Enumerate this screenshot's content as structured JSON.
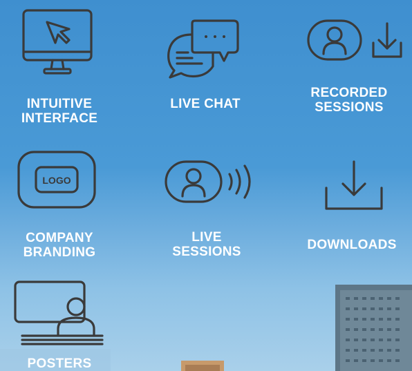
{
  "features": [
    {
      "id": "intuitive-interface",
      "label_lines": [
        "INTUITIVE",
        "INTERFACE"
      ],
      "icon": "monitor-cursor-icon"
    },
    {
      "id": "live-chat",
      "label_lines": [
        "LIVE CHAT"
      ],
      "icon": "chat-bubbles-icon"
    },
    {
      "id": "recorded-sessions",
      "label_lines": [
        "RECORDED",
        "SESSIONS"
      ],
      "icon": "user-download-icon"
    },
    {
      "id": "company-branding",
      "label_lines": [
        "COMPANY",
        "BRANDING"
      ],
      "icon": "logo-badge-icon",
      "icon_text": "LOGO"
    },
    {
      "id": "live-sessions",
      "label_lines": [
        "LIVE",
        "SESSIONS"
      ],
      "icon": "user-broadcast-icon"
    },
    {
      "id": "downloads",
      "label_lines": [
        "DOWNLOADS"
      ],
      "icon": "download-tray-icon"
    },
    {
      "id": "posters",
      "label_lines": [
        "POSTERS"
      ],
      "icon": "presenter-poster-icon"
    }
  ],
  "colors": {
    "icon_stroke": "#3a3a3a",
    "label_text": "#ffffff",
    "sky_top": "#3f8fcf",
    "sky_bottom": "#a9d0ea"
  }
}
